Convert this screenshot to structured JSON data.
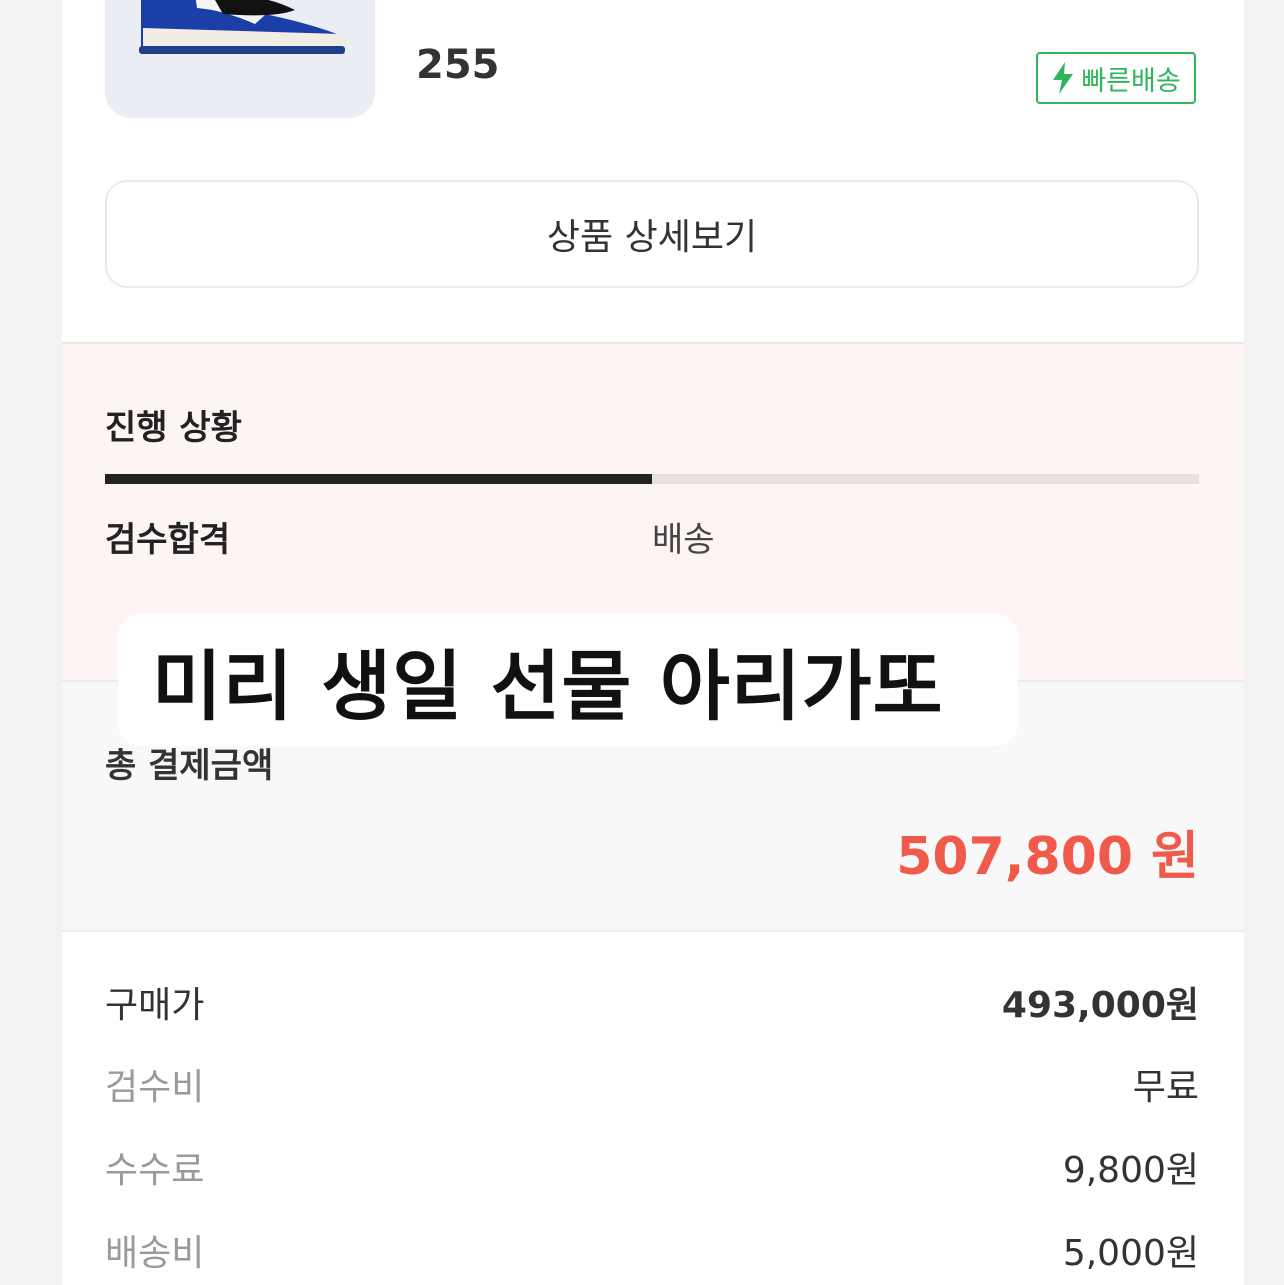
{
  "product": {
    "size": "255",
    "fast_delivery_badge": "빠른배송",
    "detail_button_label": "상품 상세보기"
  },
  "progress": {
    "title": "진행 상황",
    "current_step": "검수합격",
    "next_step": "배송",
    "completion": 0.5
  },
  "total": {
    "label": "총 결제금액",
    "amount": "507,800 원"
  },
  "breakdown": [
    {
      "label": "구매가",
      "value": "493,000원"
    },
    {
      "label": "검수비",
      "value": "무료"
    },
    {
      "label": "수수료",
      "value": "9,800원"
    },
    {
      "label": "배송비",
      "value": "5,000원"
    }
  ],
  "caption": "미리 생일 선물 아리가또",
  "colors": {
    "accent_red": "#ef5a4a",
    "badge_green": "#2fb55a",
    "progress_bg": "#fdf4f4"
  }
}
